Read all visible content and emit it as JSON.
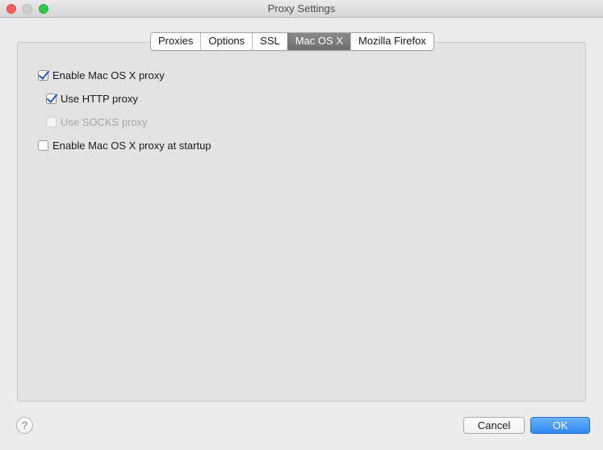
{
  "window": {
    "title": "Proxy Settings"
  },
  "tabs": [
    {
      "label": "Proxies",
      "active": false
    },
    {
      "label": "Options",
      "active": false
    },
    {
      "label": "SSL",
      "active": false
    },
    {
      "label": "Mac OS X",
      "active": true
    },
    {
      "label": "Mozilla Firefox",
      "active": false
    }
  ],
  "options": {
    "enable_proxy": {
      "label": "Enable Mac OS X proxy",
      "checked": true,
      "enabled": true
    },
    "use_http": {
      "label": "Use HTTP proxy",
      "checked": true,
      "enabled": true
    },
    "use_socks": {
      "label": "Use SOCKS proxy",
      "checked": false,
      "enabled": false
    },
    "enable_at_startup": {
      "label": "Enable Mac OS X proxy at startup",
      "checked": false,
      "enabled": true
    }
  },
  "footer": {
    "help_symbol": "?",
    "cancel_label": "Cancel",
    "ok_label": "OK"
  },
  "colors": {
    "accent": "#2f86f5",
    "checkmark": "#1f57c7",
    "close": "#fc605c",
    "maximize": "#34c84a"
  }
}
